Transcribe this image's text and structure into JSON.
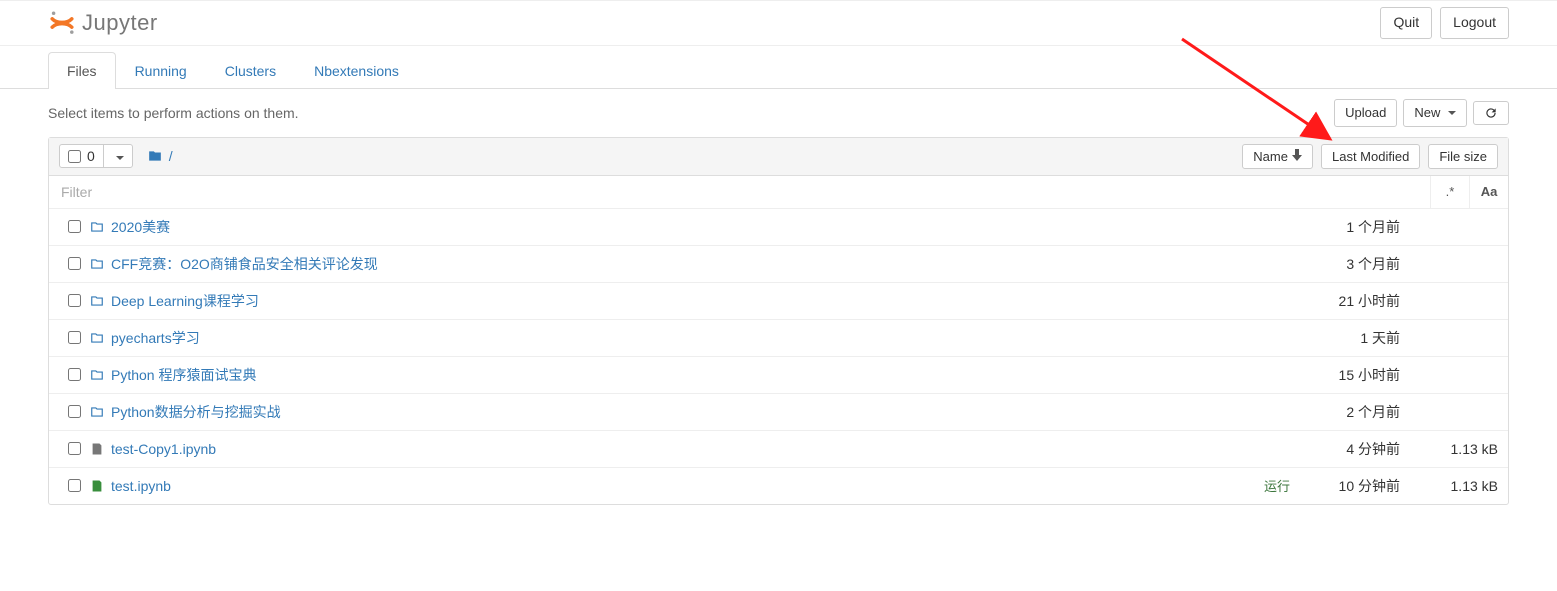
{
  "header": {
    "logo_text": "Jupyter",
    "quit": "Quit",
    "logout": "Logout"
  },
  "tabs": [
    {
      "label": "Files",
      "active": true
    },
    {
      "label": "Running",
      "active": false
    },
    {
      "label": "Clusters",
      "active": false
    },
    {
      "label": "Nbextensions",
      "active": false
    }
  ],
  "action_hint": "Select items to perform actions on them.",
  "toolbar": {
    "upload": "Upload",
    "new": "New"
  },
  "list_header": {
    "select_count": "0",
    "breadcrumb_root": "/",
    "name": "Name",
    "last_modified": "Last Modified",
    "file_size": "File size"
  },
  "filter": {
    "placeholder": "Filter",
    "regex_btn": ".*",
    "case_btn": "Aa"
  },
  "rows": [
    {
      "type": "folder",
      "name": "2020美赛",
      "time": "1 个月前",
      "size": "",
      "status": ""
    },
    {
      "type": "folder",
      "name": "CFF竞赛：O2O商铺食品安全相关评论发现",
      "time": "3 个月前",
      "size": "",
      "status": ""
    },
    {
      "type": "folder",
      "name": "Deep Learning课程学习",
      "time": "21 小时前",
      "size": "",
      "status": ""
    },
    {
      "type": "folder",
      "name": "pyecharts学习",
      "time": "1 天前",
      "size": "",
      "status": ""
    },
    {
      "type": "folder",
      "name": "Python 程序猿面试宝典",
      "time": "15 小时前",
      "size": "",
      "status": ""
    },
    {
      "type": "folder",
      "name": "Python数据分析与挖掘实战",
      "time": "2 个月前",
      "size": "",
      "status": ""
    },
    {
      "type": "notebook-idle",
      "name": "test-Copy1.ipynb",
      "time": "4 分钟前",
      "size": "1.13 kB",
      "status": ""
    },
    {
      "type": "notebook-running",
      "name": "test.ipynb",
      "time": "10 分钟前",
      "size": "1.13 kB",
      "status": "运行"
    }
  ]
}
